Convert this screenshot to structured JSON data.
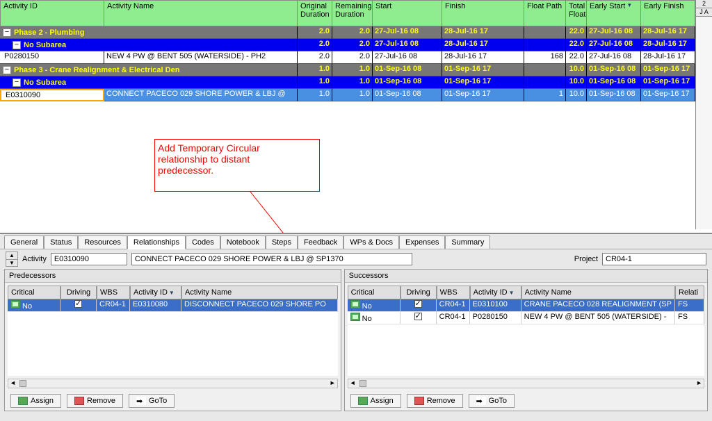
{
  "headers": {
    "activity_id": "Activity ID",
    "activity_name": "Activity Name",
    "original_duration": "Original Duration",
    "remaining_duration": "Remaining Duration",
    "start": "Start",
    "finish": "Finish",
    "float_path": "Float Path",
    "total_float": "Total Float",
    "early_start": "Early Start",
    "early_finish": "Early Finish"
  },
  "timeline": {
    "row1": "2",
    "row2": "J A"
  },
  "rows": [
    {
      "kind": "phase",
      "indent": 0,
      "label": "Phase 2 - Plumbing",
      "od": "2.0",
      "rd": "2.0",
      "st": "27-Jul-16 08",
      "fn": "28-Jul-16 17",
      "fp": "",
      "tf": "22.0",
      "es": "27-Jul-16 08",
      "ef": "28-Jul-16 17"
    },
    {
      "kind": "sub",
      "indent": 1,
      "label": "No Subarea",
      "od": "2.0",
      "rd": "2.0",
      "st": "27-Jul-16 08",
      "fn": "28-Jul-16 17",
      "fp": "",
      "tf": "22.0",
      "es": "27-Jul-16 08",
      "ef": "28-Jul-16 17"
    },
    {
      "kind": "norm",
      "indent": 2,
      "id": "P0280150",
      "name": "NEW 4 PW @ BENT 505 (WATERSIDE) - PH2",
      "od": "2.0",
      "rd": "2.0",
      "st": "27-Jul-16 08",
      "fn": "28-Jul-16 17",
      "fp": "168",
      "tf": "22.0",
      "es": "27-Jul-16 08",
      "ef": "28-Jul-16 17"
    },
    {
      "kind": "phase",
      "indent": 0,
      "label": "Phase 3 - Crane Realignment & Electrical Den",
      "od": "1.0",
      "rd": "1.0",
      "st": "01-Sep-16 08",
      "fn": "01-Sep-16 17",
      "fp": "",
      "tf": "10.0",
      "es": "01-Sep-16 08",
      "ef": "01-Sep-16 17"
    },
    {
      "kind": "sub",
      "indent": 1,
      "label": "No Subarea",
      "od": "1.0",
      "rd": "1.0",
      "st": "01-Sep-16 08",
      "fn": "01-Sep-16 17",
      "fp": "",
      "tf": "10.0",
      "es": "01-Sep-16 08",
      "ef": "01-Sep-16 17"
    },
    {
      "kind": "sel",
      "indent": 2,
      "id": "E0310090",
      "name": "CONNECT PACECO 029 SHORE POWER & LBJ @",
      "od": "1.0",
      "rd": "1.0",
      "st": "01-Sep-16 08",
      "fn": "01-Sep-16 17",
      "fp": "1",
      "tf": "10.0",
      "es": "01-Sep-16 08",
      "ef": "01-Sep-16 17"
    }
  ],
  "annotation": {
    "line1": "Add Temporary Circular",
    "line2": "relationship to distant",
    "line3": "predecessor."
  },
  "tabs": [
    "General",
    "Status",
    "Resources",
    "Relationships",
    "Codes",
    "Notebook",
    "Steps",
    "Feedback",
    "WPs & Docs",
    "Expenses",
    "Summary"
  ],
  "activeTab": "Relationships",
  "activity_bar": {
    "activity_lbl": "Activity",
    "activity_id": "E0310090",
    "activity_name": "CONNECT PACECO 029 SHORE POWER & LBJ @ SP1370",
    "project_lbl": "Project",
    "project_id": "CR04-1"
  },
  "rel_headers": {
    "critical": "Critical",
    "driving": "Driving",
    "wbs": "WBS",
    "activity_id": "Activity ID",
    "activity_name": "Activity Name",
    "relation": "Relati"
  },
  "predecessors": {
    "title": "Predecessors",
    "rows": [
      {
        "sel": true,
        "critical": "No",
        "driving": true,
        "wbs": "CR04-1",
        "aid": "E0310080",
        "aname": "DISCONNECT PACECO 029 SHORE PO"
      }
    ]
  },
  "successors": {
    "title": "Successors",
    "rows": [
      {
        "sel": true,
        "critical": "No",
        "driving": true,
        "wbs": "CR04-1",
        "aid": "E0310100",
        "aname": "CRANE PACECO 028 REALIGNMENT (SP",
        "rel": "FS"
      },
      {
        "sel": false,
        "critical": "No",
        "driving": true,
        "wbs": "CR04-1",
        "aid": "P0280150",
        "aname": "NEW 4 PW @ BENT 505 (WATERSIDE) -",
        "rel": "FS"
      }
    ]
  },
  "buttons": {
    "assign": "Assign",
    "remove": "Remove",
    "goto": "GoTo"
  }
}
